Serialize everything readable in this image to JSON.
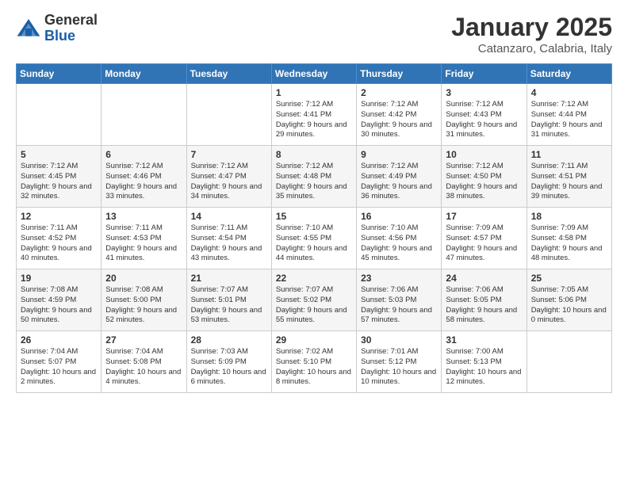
{
  "header": {
    "logo_general": "General",
    "logo_blue": "Blue",
    "month_title": "January 2025",
    "location": "Catanzaro, Calabria, Italy"
  },
  "weekdays": [
    "Sunday",
    "Monday",
    "Tuesday",
    "Wednesday",
    "Thursday",
    "Friday",
    "Saturday"
  ],
  "weeks": [
    [
      {
        "day": "",
        "info": ""
      },
      {
        "day": "",
        "info": ""
      },
      {
        "day": "",
        "info": ""
      },
      {
        "day": "1",
        "info": "Sunrise: 7:12 AM\nSunset: 4:41 PM\nDaylight: 9 hours and 29 minutes."
      },
      {
        "day": "2",
        "info": "Sunrise: 7:12 AM\nSunset: 4:42 PM\nDaylight: 9 hours and 30 minutes."
      },
      {
        "day": "3",
        "info": "Sunrise: 7:12 AM\nSunset: 4:43 PM\nDaylight: 9 hours and 31 minutes."
      },
      {
        "day": "4",
        "info": "Sunrise: 7:12 AM\nSunset: 4:44 PM\nDaylight: 9 hours and 31 minutes."
      }
    ],
    [
      {
        "day": "5",
        "info": "Sunrise: 7:12 AM\nSunset: 4:45 PM\nDaylight: 9 hours and 32 minutes."
      },
      {
        "day": "6",
        "info": "Sunrise: 7:12 AM\nSunset: 4:46 PM\nDaylight: 9 hours and 33 minutes."
      },
      {
        "day": "7",
        "info": "Sunrise: 7:12 AM\nSunset: 4:47 PM\nDaylight: 9 hours and 34 minutes."
      },
      {
        "day": "8",
        "info": "Sunrise: 7:12 AM\nSunset: 4:48 PM\nDaylight: 9 hours and 35 minutes."
      },
      {
        "day": "9",
        "info": "Sunrise: 7:12 AM\nSunset: 4:49 PM\nDaylight: 9 hours and 36 minutes."
      },
      {
        "day": "10",
        "info": "Sunrise: 7:12 AM\nSunset: 4:50 PM\nDaylight: 9 hours and 38 minutes."
      },
      {
        "day": "11",
        "info": "Sunrise: 7:11 AM\nSunset: 4:51 PM\nDaylight: 9 hours and 39 minutes."
      }
    ],
    [
      {
        "day": "12",
        "info": "Sunrise: 7:11 AM\nSunset: 4:52 PM\nDaylight: 9 hours and 40 minutes."
      },
      {
        "day": "13",
        "info": "Sunrise: 7:11 AM\nSunset: 4:53 PM\nDaylight: 9 hours and 41 minutes."
      },
      {
        "day": "14",
        "info": "Sunrise: 7:11 AM\nSunset: 4:54 PM\nDaylight: 9 hours and 43 minutes."
      },
      {
        "day": "15",
        "info": "Sunrise: 7:10 AM\nSunset: 4:55 PM\nDaylight: 9 hours and 44 minutes."
      },
      {
        "day": "16",
        "info": "Sunrise: 7:10 AM\nSunset: 4:56 PM\nDaylight: 9 hours and 45 minutes."
      },
      {
        "day": "17",
        "info": "Sunrise: 7:09 AM\nSunset: 4:57 PM\nDaylight: 9 hours and 47 minutes."
      },
      {
        "day": "18",
        "info": "Sunrise: 7:09 AM\nSunset: 4:58 PM\nDaylight: 9 hours and 48 minutes."
      }
    ],
    [
      {
        "day": "19",
        "info": "Sunrise: 7:08 AM\nSunset: 4:59 PM\nDaylight: 9 hours and 50 minutes."
      },
      {
        "day": "20",
        "info": "Sunrise: 7:08 AM\nSunset: 5:00 PM\nDaylight: 9 hours and 52 minutes."
      },
      {
        "day": "21",
        "info": "Sunrise: 7:07 AM\nSunset: 5:01 PM\nDaylight: 9 hours and 53 minutes."
      },
      {
        "day": "22",
        "info": "Sunrise: 7:07 AM\nSunset: 5:02 PM\nDaylight: 9 hours and 55 minutes."
      },
      {
        "day": "23",
        "info": "Sunrise: 7:06 AM\nSunset: 5:03 PM\nDaylight: 9 hours and 57 minutes."
      },
      {
        "day": "24",
        "info": "Sunrise: 7:06 AM\nSunset: 5:05 PM\nDaylight: 9 hours and 58 minutes."
      },
      {
        "day": "25",
        "info": "Sunrise: 7:05 AM\nSunset: 5:06 PM\nDaylight: 10 hours and 0 minutes."
      }
    ],
    [
      {
        "day": "26",
        "info": "Sunrise: 7:04 AM\nSunset: 5:07 PM\nDaylight: 10 hours and 2 minutes."
      },
      {
        "day": "27",
        "info": "Sunrise: 7:04 AM\nSunset: 5:08 PM\nDaylight: 10 hours and 4 minutes."
      },
      {
        "day": "28",
        "info": "Sunrise: 7:03 AM\nSunset: 5:09 PM\nDaylight: 10 hours and 6 minutes."
      },
      {
        "day": "29",
        "info": "Sunrise: 7:02 AM\nSunset: 5:10 PM\nDaylight: 10 hours and 8 minutes."
      },
      {
        "day": "30",
        "info": "Sunrise: 7:01 AM\nSunset: 5:12 PM\nDaylight: 10 hours and 10 minutes."
      },
      {
        "day": "31",
        "info": "Sunrise: 7:00 AM\nSunset: 5:13 PM\nDaylight: 10 hours and 12 minutes."
      },
      {
        "day": "",
        "info": ""
      }
    ]
  ]
}
